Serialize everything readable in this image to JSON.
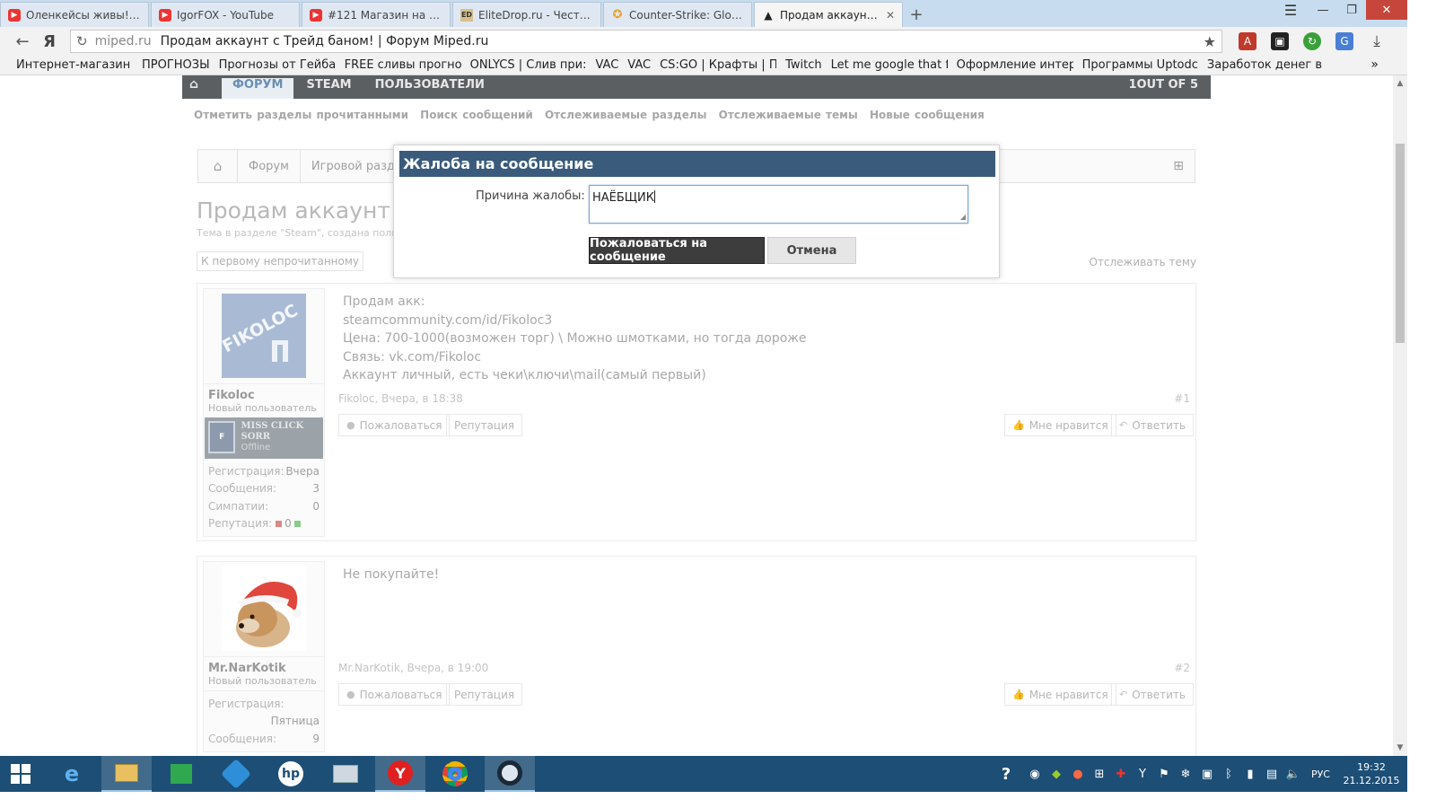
{
  "browser": {
    "tabs": [
      {
        "icon": "youtube-icon",
        "label": "Оленкейсы живы! [#"
      },
      {
        "icon": "youtube-icon",
        "label": "IgorFOX - YouTube"
      },
      {
        "icon": "youtube-icon",
        "label": "#121 Магазин на про"
      },
      {
        "icon": "elitedrop-icon",
        "label": "EliteDrop.ru - Честная"
      },
      {
        "icon": "counter-strike-icon",
        "label": "Counter-Strike: Global"
      },
      {
        "icon": "penguin-icon",
        "label": "Продам аккаунт с Тре",
        "active": true
      }
    ],
    "address": {
      "domain": "miped.ru",
      "title": "Продам аккаунт с Трейд баном! | Форум Miped.ru"
    },
    "bookmarks": [
      "Интернет-магазин (",
      "ПРОГНОЗЫ",
      "Прогнозы от Гейба",
      "FREE сливы прогно:",
      "ONLYCS | Слив при:",
      "VAC",
      "VAC",
      "CS:GO | Крафты | Пр",
      "Twitch",
      "Let me google that f",
      "Оформление интер",
      "Программы Uptodc",
      "Заработок денег в :"
    ],
    "bookmarks_more": "»"
  },
  "forum": {
    "topnav": {
      "items": [
        "ФОРУМ",
        "STEAM",
        "ПОЛЬЗОВАТЕЛИ"
      ],
      "right": "1OUT OF 5"
    },
    "subnav": [
      "Отметить разделы прочитанными",
      "Поиск сообщений",
      "Отслеживаемые разделы",
      "Отслеживаемые темы",
      "Новые сообщения"
    ],
    "breadcrumbs": [
      "Форум",
      "Игровой раздел"
    ],
    "thread_title": "Продам аккаунт с Т",
    "thread_sub": "Тема в разделе \"Steam\", создана поль",
    "first_unread": "К первому непрочитанному",
    "watch_thread": "Отслеживать тему",
    "posts": [
      {
        "user": {
          "name": "Fikoloc",
          "title": "Новый пользователь",
          "banner_name": "MISS CLICK SORR",
          "banner_status": "Offline",
          "stats": [
            {
              "label": "Регистрация:",
              "value": "Вчера"
            },
            {
              "label": "Сообщения:",
              "value": "3"
            },
            {
              "label": "Симпатии:",
              "value": "0"
            }
          ],
          "reputation_label": "Репутация:",
          "reputation_value": "0"
        },
        "lines": [
          "Продам акк:",
          "steamcommunity.com/id/Fikoloc3",
          "Цена: 700-1000(возможен торг) \\ Можно шмотками, но тогда дороже",
          "Связь: vk.com/Fikoloc",
          "Аккаунт личный, есть чеки\\ключи\\mail(самый первый)"
        ],
        "meta": "Fikoloc, Вчера, в 18:38",
        "number": "#1"
      },
      {
        "user": {
          "name": "Mr.NarKotik",
          "title": "Новый пользователь",
          "stats": [
            {
              "label": "Регистрация:",
              "value": ""
            },
            {
              "label": "",
              "value": "Пятница"
            },
            {
              "label": "Сообщения:",
              "value": "9"
            }
          ]
        },
        "lines": [
          "Не покупайте!"
        ],
        "meta": "Mr.NarKotik, Вчера, в 19:00",
        "number": "#2"
      }
    ],
    "actions": {
      "report": "Пожаловаться",
      "reputation": "Репутация",
      "like": "Мне нравится",
      "reply": "Ответить"
    }
  },
  "dialog": {
    "title": "Жалоба на сообщение",
    "reason_label": "Причина жалобы:",
    "reason_value": "НАЁБЩИК",
    "submit": "Пожаловаться на сообщение",
    "cancel": "Отмена"
  },
  "taskbar": {
    "language": "РУС",
    "time": "19:32",
    "date": "21.12.2015"
  },
  "colors": {
    "dialog_header": "#3a5b7c",
    "taskbar": "#1d4e75",
    "submit_button": "#3d3d3d"
  }
}
